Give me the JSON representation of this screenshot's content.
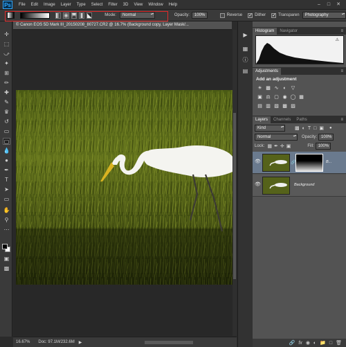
{
  "app": {
    "logo": "Ps"
  },
  "menu": [
    "File",
    "Edit",
    "Image",
    "Layer",
    "Type",
    "Select",
    "Filter",
    "3D",
    "View",
    "Window",
    "Help"
  ],
  "window_controls": {
    "minimize": "–",
    "maximize": "□",
    "close": "✕"
  },
  "options": {
    "mode_label": "Mode:",
    "mode_value": "Normal",
    "opacity_label": "Opacity:",
    "opacity_value": "100%",
    "reverse_label": "Reverse",
    "reverse_checked": false,
    "dither_label": "Dither",
    "dither_checked": true,
    "transparency_label": "Transparen",
    "transparency_checked": true,
    "workspace_value": "Photography",
    "highlight_color": "#e32a2a"
  },
  "document": {
    "tab_title": "© Canon EOS 5D Mark III_20150208_80727.CR2 @ 16.7% (Background copy, Layer Mask/...",
    "close_icon": "×"
  },
  "status": {
    "zoom": "16.67%",
    "doc_info": "Doc: 97.1M/232.6M",
    "arrow": "▶"
  },
  "panels": {
    "histogram_tabs": [
      {
        "label": "Histogram",
        "active": true
      },
      {
        "label": "Navigator",
        "active": false
      }
    ],
    "histogram_warning": "⚠",
    "adjustments_tab": "Adjustments",
    "add_adjustment": "Add an adjustment",
    "layers_tabs": [
      {
        "label": "Layers",
        "active": true
      },
      {
        "label": "Channels",
        "active": false
      },
      {
        "label": "Paths",
        "active": false
      }
    ],
    "kind_value": "Kind",
    "blend_value": "Normal",
    "opacity_label": "Opacity:",
    "opacity_value": "100%",
    "lock_label": "Lock:",
    "fill_label": "Fill:",
    "fill_value": "100%",
    "layers": [
      {
        "name": "B...",
        "selected": true,
        "has_mask": true
      },
      {
        "name": "Background",
        "selected": false,
        "has_mask": false
      }
    ],
    "menu_icon": "≡"
  },
  "colors": {
    "foreground": "#000000",
    "background": "#ffffff",
    "selected_layer": "#6a7a8e",
    "ps_blue": "#31a8ff"
  }
}
